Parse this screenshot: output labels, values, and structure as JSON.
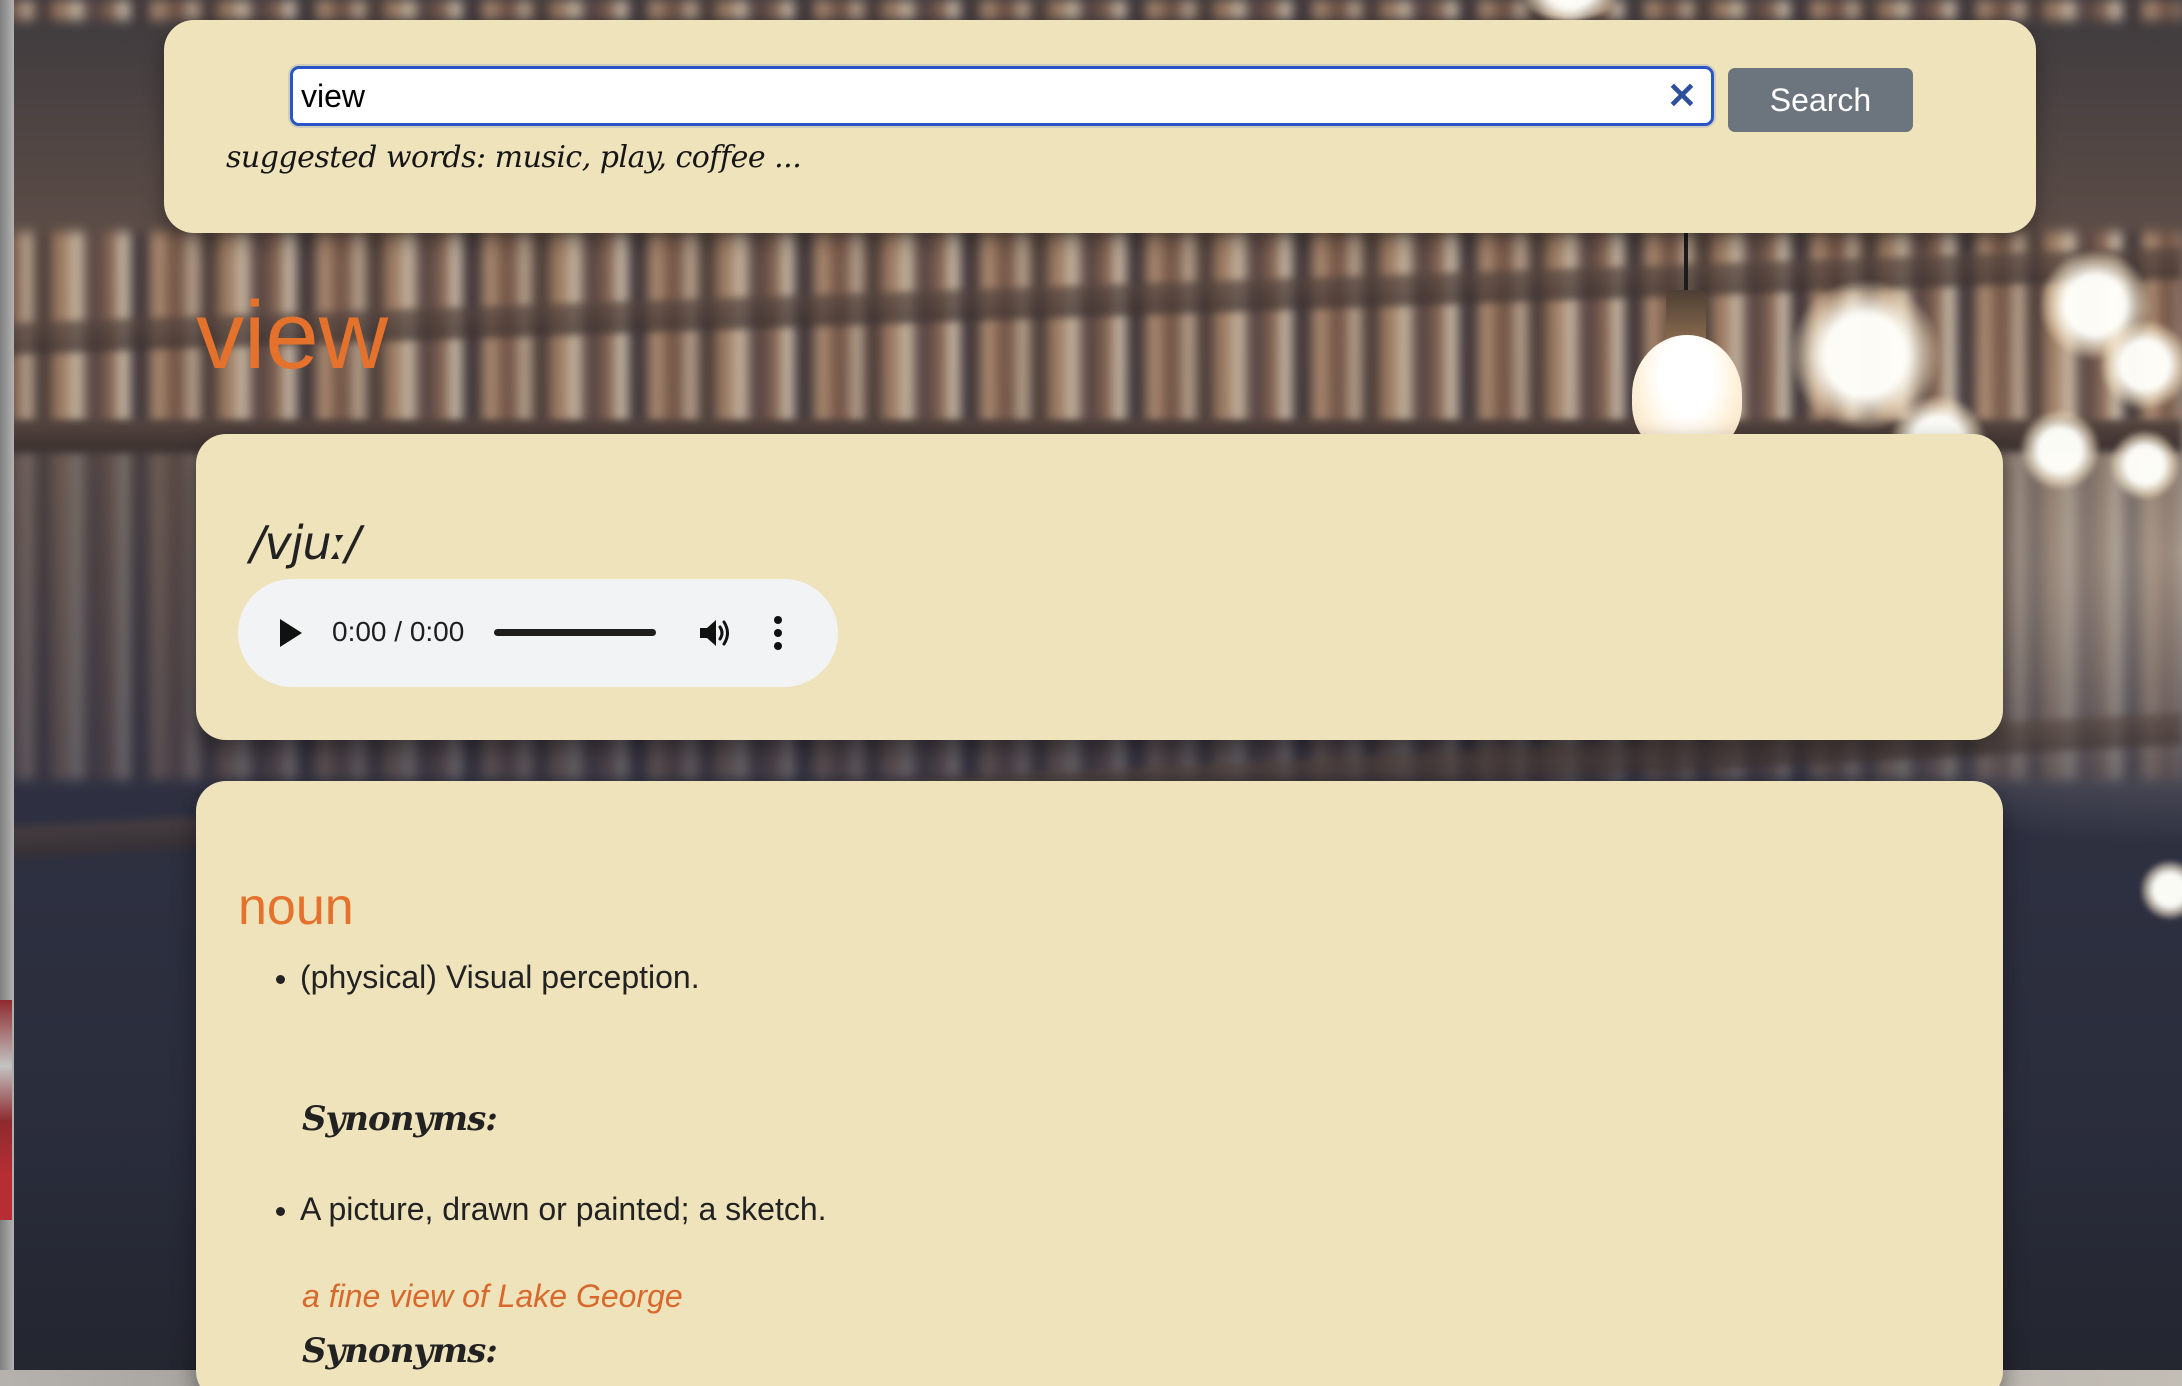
{
  "search": {
    "value": "view",
    "clear_symbol": "✕",
    "button_label": "Search",
    "suggested_text": "suggested words: music, play, coffee ..."
  },
  "word": {
    "title": "view",
    "phonetic": "/vjuː/"
  },
  "audio": {
    "time": "0:00 / 0:00",
    "icons": [
      "play-icon",
      "volume-icon",
      "more-options-icon"
    ]
  },
  "meanings": [
    {
      "part_of_speech": "noun",
      "definitions": [
        {
          "text": "(physical) Visual perception.",
          "synonyms_label": "Synonyms:"
        },
        {
          "text": "A picture, drawn or painted; a sketch.",
          "example": "a fine view of Lake George",
          "synonyms_label": "Synonyms:"
        }
      ]
    }
  ],
  "colors": {
    "accent": "#e4722c",
    "card_bg": "#efe3bc",
    "search_button": "#6c757d",
    "input_focus": "#2956c4"
  }
}
